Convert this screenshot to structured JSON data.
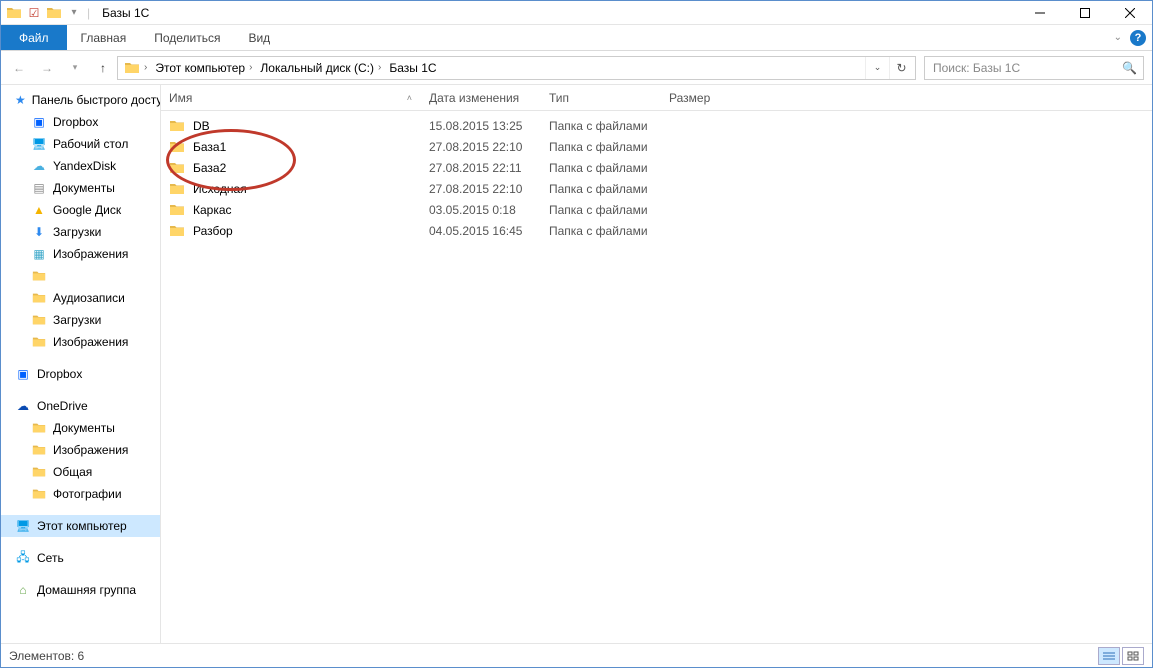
{
  "window": {
    "title": "Базы 1С"
  },
  "ribbon": {
    "file": "Файл",
    "tabs": [
      "Главная",
      "Поделиться",
      "Вид"
    ]
  },
  "breadcrumb": {
    "segments": [
      "Этот компьютер",
      "Локальный диск (C:)",
      "Базы 1С"
    ]
  },
  "search": {
    "placeholder": "Поиск: Базы 1С"
  },
  "nav": {
    "favorites": {
      "label": "Панель быстрого доступа",
      "items": [
        "Dropbox",
        "Рабочий стол",
        "YandexDisk",
        "Документы",
        "Google Диск",
        "Загрузки",
        "Изображения",
        "",
        "Аудиозаписи",
        "Загрузки",
        "Изображения"
      ]
    },
    "dropbox": "Dropbox",
    "onedrive": {
      "label": "OneDrive",
      "items": [
        "Документы",
        "Изображения",
        "Общая",
        "Фотографии"
      ]
    },
    "thispc": "Этот компьютер",
    "network": "Сеть",
    "homegroup": "Домашняя группа"
  },
  "columns": {
    "name": "Имя",
    "date": "Дата изменения",
    "type": "Тип",
    "size": "Размер"
  },
  "files": [
    {
      "name": "DB",
      "date": "15.08.2015 13:25",
      "type": "Папка с файлами"
    },
    {
      "name": "База1",
      "date": "27.08.2015 22:10",
      "type": "Папка с файлами"
    },
    {
      "name": "База2",
      "date": "27.08.2015 22:11",
      "type": "Папка с файлами"
    },
    {
      "name": "Исходная",
      "date": "27.08.2015 22:10",
      "type": "Папка с файлами"
    },
    {
      "name": "Каркас",
      "date": "03.05.2015 0:18",
      "type": "Папка с файлами"
    },
    {
      "name": "Разбор",
      "date": "04.05.2015 16:45",
      "type": "Папка с файлами"
    }
  ],
  "status": {
    "count_label": "Элементов: 6"
  }
}
